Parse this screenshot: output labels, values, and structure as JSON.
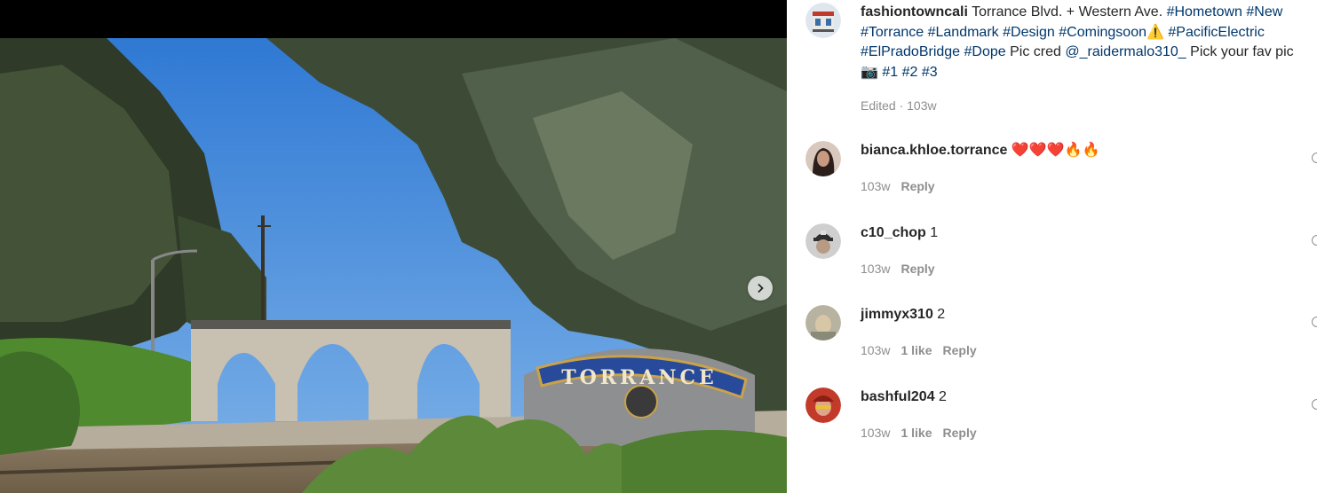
{
  "post": {
    "username": "fashiontowncali",
    "caption_line1": " Torrance Blvd. + Western Ave. ",
    "tags_line1": [
      "#Hometown",
      "#New"
    ],
    "tags_line2": [
      "#Torrance",
      "#Landmark",
      "#Design",
      "#Comingsoon"
    ],
    "warning_emoji": "⚠️",
    "tags_line2b": [
      "#PacificElectric"
    ],
    "tags_line3": [
      "#ElPradoBridge",
      "#Dope"
    ],
    "pic_cred": " Pic cred ",
    "mention": "@_raidermalo310_",
    "pick_text": "  Pick your fav pic",
    "camera_emoji": "📷",
    "tags_line4": [
      "#1",
      "#2",
      "#3"
    ],
    "edited": "Edited · 103w",
    "sign_text": "TORRANCE"
  },
  "comments": [
    {
      "username": "bianca.khloe.torrance",
      "text": "❤️❤️❤️🔥🔥",
      "time": "103w",
      "likes": "",
      "reply": "Reply"
    },
    {
      "username": "c10_chop",
      "text": "1",
      "time": "103w",
      "likes": "",
      "reply": "Reply"
    },
    {
      "username": "jimmyx310",
      "text": "2",
      "time": "103w",
      "likes": "1 like",
      "reply": "Reply"
    },
    {
      "username": "bashful204",
      "text": "2",
      "time": "103w",
      "likes": "1 like",
      "reply": "Reply"
    }
  ],
  "colors": {
    "link": "#00376b",
    "muted": "#8e8e8e",
    "text": "#262626",
    "sky": "#3d86d9",
    "sign_blue": "#274a9b"
  }
}
